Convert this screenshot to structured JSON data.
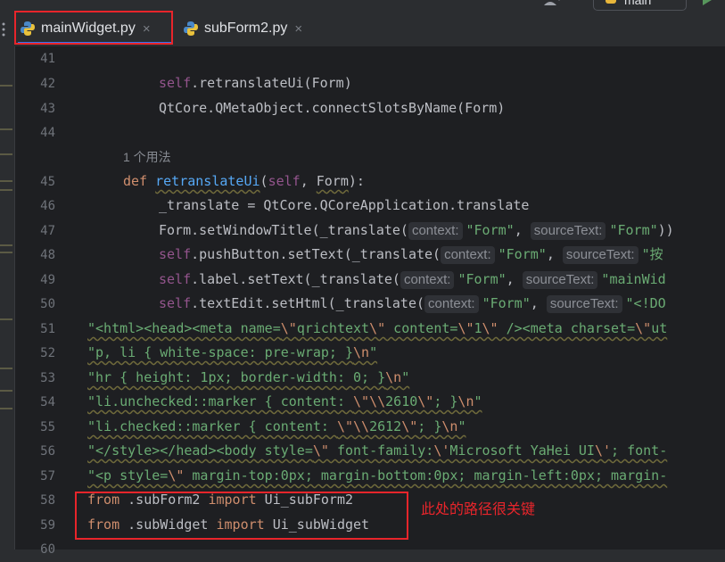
{
  "tabs": [
    {
      "label": "mainWidget.py",
      "close": "×",
      "active": true
    },
    {
      "label": "subForm2.py",
      "close": "×",
      "active": false
    }
  ],
  "toolbar": {
    "branch": "main"
  },
  "lines": [
    {
      "num": "41"
    },
    {
      "num": "42",
      "code": "self.retranslateUi(Form)"
    },
    {
      "num": "43",
      "code": "QtCore.QMetaObject.connectSlotsByName(Form)"
    },
    {
      "num": "44"
    },
    {
      "usage": "1 个用法"
    },
    {
      "num": "45",
      "code": "def retranslateUi(self, Form):"
    },
    {
      "num": "46",
      "code": "_translate = QtCore.QCoreApplication.translate"
    },
    {
      "num": "47",
      "code": "Form.setWindowTitle(_translate(context: \"Form\", sourceText: \"Form\"))"
    },
    {
      "num": "48",
      "code": "self.pushButton.setText(_translate(context: \"Form\", sourceText: \"按"
    },
    {
      "num": "49",
      "code": "self.label.setText(_translate(context: \"Form\", sourceText: \"mainWid"
    },
    {
      "num": "50",
      "code": "self.textEdit.setHtml(_translate(context: \"Form\", sourceText: \"<!DO"
    },
    {
      "num": "51",
      "code": "\"<html><head><meta name=\\\"qrichtext\\\" content=\\\"1\\\" /><meta charset=\\\"ut"
    },
    {
      "num": "52",
      "code": "\"p, li { white-space: pre-wrap; }\\n\""
    },
    {
      "num": "53",
      "code": "\"hr { height: 1px; border-width: 0; }\\n\""
    },
    {
      "num": "54",
      "code": "\"li.unchecked::marker { content: \\\"\\\\2610\\\"; }\\n\""
    },
    {
      "num": "55",
      "code": "\"li.checked::marker { content: \\\"\\\\2612\\\"; }\\n\""
    },
    {
      "num": "56",
      "code": "\"</style></head><body style=\\\" font-family:\\'Microsoft YaHei UI\\'; font-"
    },
    {
      "num": "57",
      "code": "\"<p style=\\\" margin-top:0px; margin-bottom:0px; margin-left:0px; margin-"
    },
    {
      "num": "58",
      "code": "from .subForm2 import Ui_subForm2"
    },
    {
      "num": "59",
      "code": "from .subWidget import Ui_subWidget"
    },
    {
      "num": "60"
    }
  ],
  "hints": {
    "context": "context:",
    "sourceText": "sourceText:"
  },
  "annotation": "此处的路径很关键",
  "colors": {
    "highlight_box": "#e8252b",
    "keyword": "#cf8e6d",
    "string": "#6aab73",
    "self": "#94558d",
    "function": "#56a8f5"
  }
}
